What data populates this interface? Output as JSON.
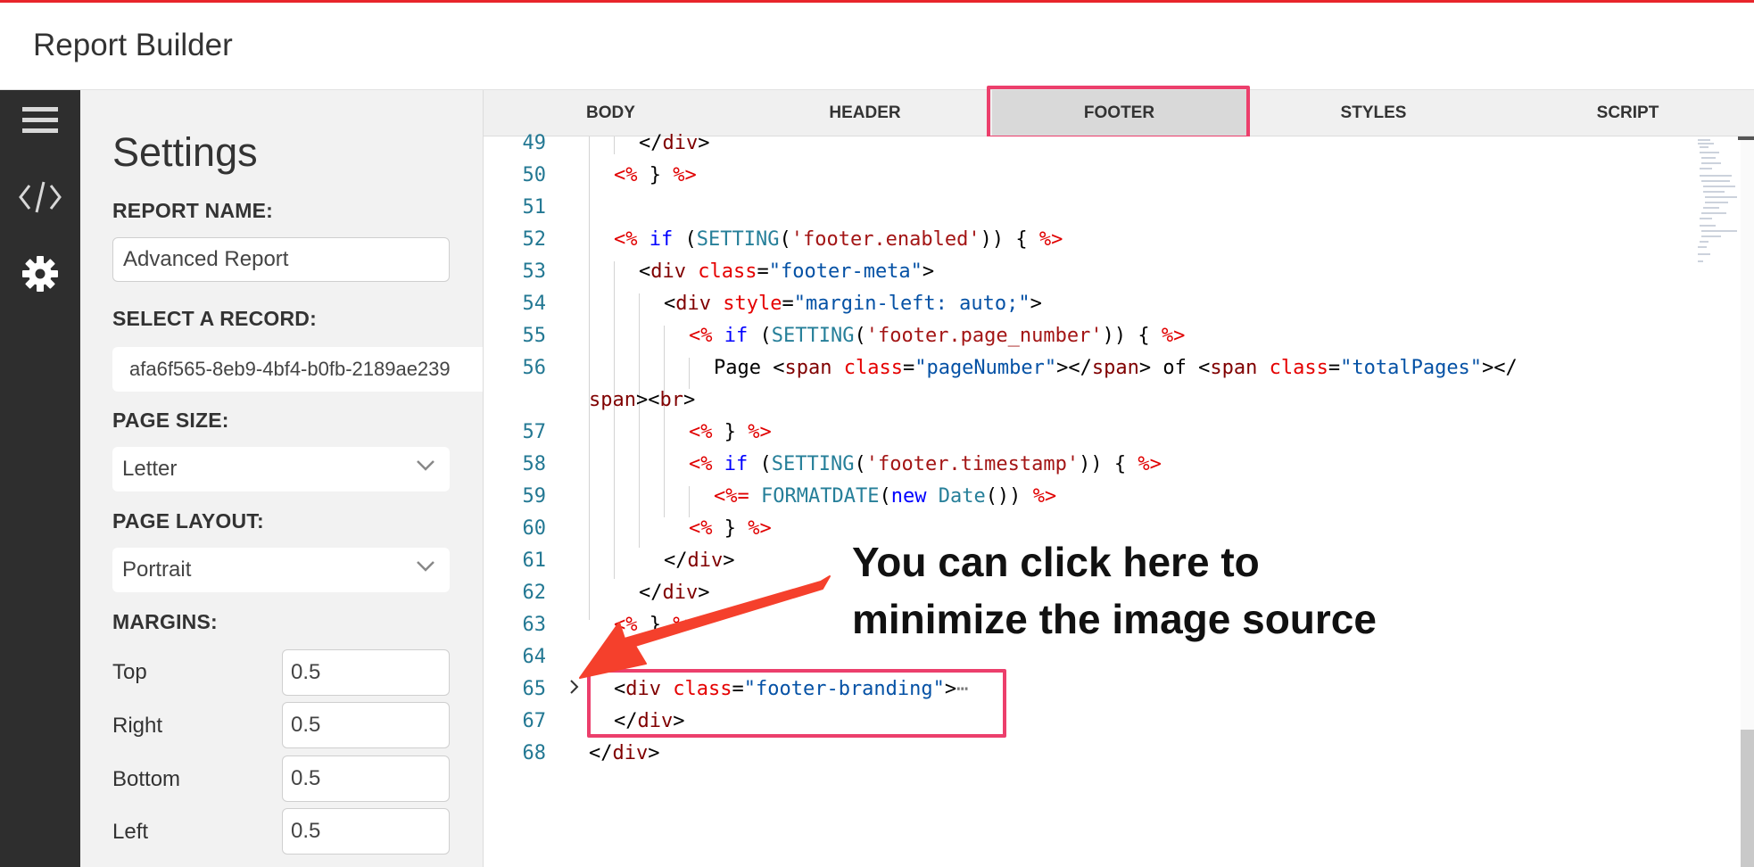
{
  "app": {
    "title": "Report Builder"
  },
  "rail": {
    "icons": [
      "menu-icon",
      "code-icon",
      "gear-icon"
    ]
  },
  "settings": {
    "title": "Settings",
    "report_name_label": "REPORT NAME:",
    "report_name_value": "Advanced Report",
    "record_label": "SELECT A RECORD:",
    "record_value": "afa6f565-8eb9-4bf4-b0fb-2189ae239",
    "page_size_label": "PAGE SIZE:",
    "page_size_value": "Letter",
    "page_layout_label": "PAGE LAYOUT:",
    "page_layout_value": "Portrait",
    "margins_label": "MARGINS:",
    "margins": [
      {
        "label": "Top",
        "value": "0.5"
      },
      {
        "label": "Right",
        "value": "0.5"
      },
      {
        "label": "Bottom",
        "value": "0.5"
      },
      {
        "label": "Left",
        "value": "0.5"
      }
    ]
  },
  "tabs": [
    {
      "label": "BODY",
      "active": false
    },
    {
      "label": "HEADER",
      "active": false
    },
    {
      "label": "FOOTER",
      "active": true
    },
    {
      "label": "STYLES",
      "active": false
    },
    {
      "label": "SCRIPT",
      "active": false
    }
  ],
  "editor": {
    "line_numbers": [
      "49",
      "50",
      "51",
      "52",
      "53",
      "54",
      "55",
      "56",
      "57",
      "58",
      "59",
      "60",
      "61",
      "62",
      "63",
      "64",
      "65",
      "67",
      "68"
    ],
    "lines": {
      "l49": {
        "tag": "div"
      },
      "l50": {
        "open": "<%",
        "brace": "}",
        "close": "%>"
      },
      "l52": {
        "open": "<%",
        "kw": "if",
        "fn": "SETTING",
        "str": "'footer.enabled'",
        "rest": ")) {",
        "close": "%>"
      },
      "l53": {
        "tag": "div",
        "attr": "class",
        "val": "\"footer-meta\""
      },
      "l54": {
        "tag": "div",
        "attr": "style",
        "val": "\"margin-left: auto;\""
      },
      "l55": {
        "open": "<%",
        "kw": "if",
        "fn": "SETTING",
        "str": "'footer.page_number'",
        "rest": ")) {",
        "close": "%>"
      },
      "l56": {
        "text1": "Page",
        "tag": "span",
        "attr": "class",
        "val1": "\"pageNumber\"",
        "text2": "of",
        "val2": "\"totalPages\"",
        "wrap_tag": "span",
        "br": "br"
      },
      "l57": {
        "open": "<%",
        "brace": "}",
        "close": "%>"
      },
      "l58": {
        "open": "<%",
        "kw": "if",
        "fn": "SETTING",
        "str": "'footer.timestamp'",
        "rest": ")) {",
        "close": "%>"
      },
      "l59": {
        "open": "<%=",
        "fn": "FORMATDATE",
        "kw": "new",
        "cls": "Date",
        "rest": "())",
        "close": "%>"
      },
      "l60": {
        "open": "<%",
        "brace": "}",
        "close": "%>"
      },
      "l61": {
        "tag": "div"
      },
      "l62": {
        "tag": "div"
      },
      "l63": {
        "open": "<%",
        "brace": "}",
        "close": "%>"
      },
      "l65": {
        "tag": "div",
        "attr": "class",
        "val": "\"footer-branding\"",
        "ellipsis": "⋯"
      },
      "l67": {
        "tag": "div"
      },
      "l68": {
        "tag": "div"
      }
    }
  },
  "annotation": {
    "line1": "You can click here to",
    "line2": "minimize the image source",
    "arrow_color": "#f5402c",
    "highlight_color": "#ec3f6c"
  },
  "colors": {
    "top_accent": "#e8252b",
    "rail": "#2e2e2e",
    "settings_bg": "#f2f2f2"
  }
}
